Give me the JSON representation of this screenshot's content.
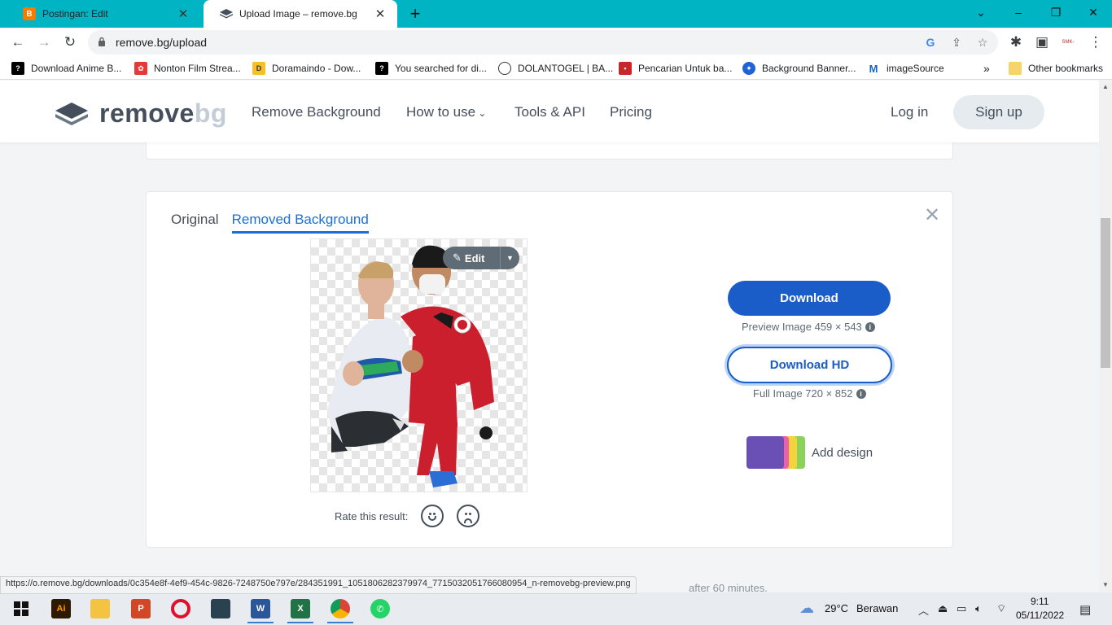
{
  "browser": {
    "tabs": [
      {
        "title": "Postingan: Edit",
        "icon": "blogger-icon",
        "active": false
      },
      {
        "title": "Upload Image – remove.bg",
        "icon": "removebg-icon",
        "active": true
      }
    ],
    "url": "remove.bg/upload",
    "bookmarks": [
      {
        "label": "Download Anime B...",
        "color": "#000000"
      },
      {
        "label": "Nonton Film Strea...",
        "color": "#e53935"
      },
      {
        "label": "Doramaindo - Dow...",
        "color": "#f6c026"
      },
      {
        "label": "You searched for di...",
        "color": "#000000"
      },
      {
        "label": "DOLANTOGEL | BA...",
        "color": "#333333"
      },
      {
        "label": "Pencarian Untuk ba...",
        "color": "#c62828"
      },
      {
        "label": "Background Banner...",
        "color": "#1e63d6"
      },
      {
        "label": "imageSource",
        "color": "#1565c0"
      }
    ],
    "other_bookmarks": "Other bookmarks",
    "bookmarks_more": "»",
    "profile_badge": "SMK-Net"
  },
  "site": {
    "logo_main": "remove",
    "logo_bg": "bg",
    "nav": [
      "Remove Background",
      "How to use",
      "Tools & API",
      "Pricing"
    ],
    "login": "Log in",
    "signup": "Sign up"
  },
  "result": {
    "tab_original": "Original",
    "tab_removed": "Removed Background",
    "edit_label": "Edit",
    "download_label": "Download",
    "preview_info": "Preview Image 459 × 543",
    "download_hd_label": "Download HD",
    "full_info": "Full Image 720 × 852",
    "add_design": "Add design",
    "rate_label": "Rate this result:"
  },
  "page_note": "after 60 minutes.",
  "status_url": "https://o.remove.bg/downloads/0c354e8f-4ef9-454c-9826-7248750e797e/284351991_1051806282379974_7715032051766080954_n-removebg-preview.png",
  "taskbar": {
    "weather_temp": "29°C",
    "weather_text": "Berawan",
    "time": "9:11",
    "date": "05/11/2022",
    "apps": [
      "windows-start",
      "illustrator",
      "file-explorer",
      "powerpoint",
      "opera",
      "photo-app",
      "word",
      "excel",
      "chrome",
      "whatsapp"
    ]
  },
  "colors": {
    "tabbar": "#00b4c4",
    "primary": "#1a5cc8",
    "active_tab": "#1a6fd6"
  }
}
